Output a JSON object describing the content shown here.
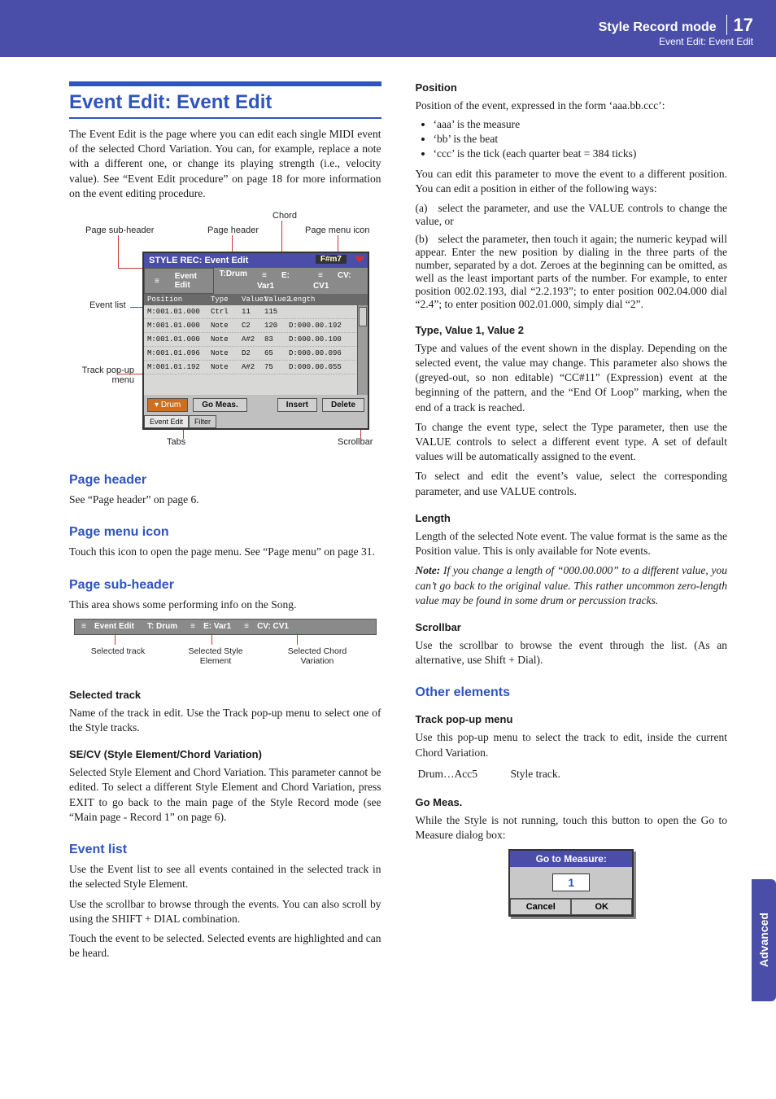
{
  "header_band": {
    "title": "Style Record mode",
    "subtitle": "Event Edit: Event Edit",
    "page_number": "17"
  },
  "side_tab": "Advanced",
  "left": {
    "section_title": "Event Edit: Event Edit",
    "intro": "The Event Edit is the page where you can edit each single MIDI event of the selected Chord Variation. You can, for example, replace a note with a different one, or change its playing strength (i.e., velocity value). See “Event Edit procedure” on page 18 for more information on the event editing procedure.",
    "diagram_labels": {
      "chord": "Chord",
      "page_sub_header": "Page sub-header",
      "page_header": "Page header",
      "page_menu_icon": "Page menu icon",
      "event_list": "Event list",
      "track_popup": "Track pop-up menu",
      "tabs": "Tabs",
      "scrollbar": "Scrollbar"
    },
    "device": {
      "title": "STYLE REC: Event Edit",
      "chord_badge": "F#m7",
      "sub": {
        "ee": "Event Edit",
        "track": "T:Drum",
        "e": "E: Var1",
        "cv": "CV: CV1"
      },
      "list_header": {
        "pos": "Position",
        "type": "Type",
        "v1": "Value1",
        "v2": "Value2",
        "len": "Length"
      },
      "rows": [
        {
          "pos": "M:001.01.000",
          "type": "Ctrl",
          "v1": "11",
          "v2": "115",
          "len": ""
        },
        {
          "pos": "M:001.01.000",
          "type": "Note",
          "v1": "C2",
          "v2": "120",
          "len": "D:000.00.192"
        },
        {
          "pos": "M:001.01.000",
          "type": "Note",
          "v1": "A#2",
          "v2": "83",
          "len": "D:000.00.100"
        },
        {
          "pos": "M:001.01.096",
          "type": "Note",
          "v1": "D2",
          "v2": "65",
          "len": "D:000.00.096"
        },
        {
          "pos": "M:001.01.192",
          "type": "Note",
          "v1": "A#2",
          "v2": "75",
          "len": "D:000.00.055"
        }
      ],
      "dropdown": "Drum",
      "btn_go": "Go Meas.",
      "btn_insert": "Insert",
      "btn_delete": "Delete",
      "tab1": "Event Edit",
      "tab2": "Filter"
    },
    "h_page_header": "Page header",
    "p_page_header": "See “Page header” on page 6.",
    "h_page_menu_icon": "Page menu icon",
    "p_page_menu_icon": "Touch this icon to open the page menu. See “Page menu” on page 31.",
    "h_page_sub_header": "Page sub-header",
    "p_page_sub_header": "This area shows some performing info on the Song.",
    "subhdr_fig": {
      "ee": "Event Edit",
      "track": "T: Drum",
      "e": "E: Var1",
      "cv": "CV: CV1",
      "lbl_track": "Selected track",
      "lbl_se": "Selected Style Element",
      "lbl_cv": "Selected Chord Variation"
    },
    "h_selected_track": "Selected track",
    "p_selected_track": "Name of the track in edit. Use the Track pop-up menu to select one of the Style tracks.",
    "h_secv": "SE/CV (Style Element/Chord Variation)",
    "p_secv": "Selected Style Element and Chord Variation. This parameter cannot be edited. To select a different Style Element and Chord Variation, press EXIT to go back to the main page of the Style Record mode (see “Main page - Record 1” on page 6).",
    "h_event_list": "Event list",
    "p_event_list_1": "Use the Event list to see all events contained in the selected track in the selected Style Element.",
    "p_event_list_2": "Use the scrollbar to browse through the events. You can also scroll by using the SHIFT + DIAL combination.",
    "p_event_list_3": "Touch the event to be selected. Selected events are highlighted and can be heard."
  },
  "right": {
    "h_position": "Position",
    "p_position_lead": "Position of the event, expressed in the form ‘aaa.bb.ccc’:",
    "pos_bullets": [
      "‘aaa’ is the measure",
      "‘bb’ is the beat",
      "‘ccc’ is the tick (each quarter beat = 384 ticks)"
    ],
    "p_position_2": "You can edit this parameter to move the event to a different position. You can edit a position in either of the following ways:",
    "pos_a": "select the parameter, and use the VALUE controls to change the value, or",
    "pos_b": "select the parameter, then touch it again; the numeric keypad will appear. Enter the new position by dialing in the three parts of the number, separated by a dot. Zeroes at the beginning can be omitted, as well as the least important parts of the number. For example, to enter position 002.02.193, dial “2.2.193”; to enter position 002.04.000 dial “2.4”; to enter position 002.01.000, simply dial “2”.",
    "h_tvv": "Type, Value 1, Value 2",
    "p_tvv_1": "Type and values of the event shown in the display. Depending on the selected event, the value may change. This parameter also shows the (greyed-out, so non editable) “CC#11” (Expression) event at the beginning of the pattern, and the “End Of Loop” marking, when the end of a track is reached.",
    "p_tvv_2": "To change the event type, select the Type parameter, then use the VALUE controls to select a different event type. A set of default values will be automatically assigned to the event.",
    "p_tvv_3": "To select and edit the event’s value, select the corresponding parameter, and use VALUE controls.",
    "h_length": "Length",
    "p_length_1": "Length of the selected Note event. The value format is the same as the Position value. This is only available for Note events.",
    "note_label": "Note:",
    "p_length_note": " If you change a length of “000.00.000” to a different value, you can’t go back to the original value. This rather uncommon zero-length value may be found in some drum or percussion tracks.",
    "h_scrollbar": "Scrollbar",
    "p_scrollbar": "Use the scrollbar to browse the event through the list. (As an alternative, use Shift + Dial).",
    "h_other": "Other elements",
    "h_trackpop": "Track pop-up menu",
    "p_trackpop": "Use this pop-up menu to select the track to edit, inside the current Chord Variation.",
    "track_range_k": "Drum…Acc5",
    "track_range_v": "Style track.",
    "h_gomeas": "Go Meas.",
    "p_gomeas": "While the Style is not running, touch this button to open the Go to Measure dialog box:",
    "dialog": {
      "title": "Go to Measure:",
      "value": "1",
      "cancel": "Cancel",
      "ok": "OK"
    }
  }
}
